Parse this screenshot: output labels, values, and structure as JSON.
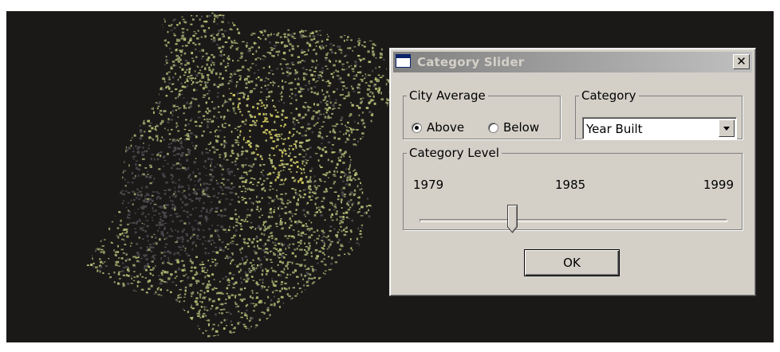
{
  "dialog": {
    "title": "Category Slider",
    "close_glyph": "✕",
    "city_average": {
      "legend": "City Average",
      "options": [
        "Above",
        "Below"
      ],
      "selected": "Above"
    },
    "category": {
      "legend": "Category",
      "selected": "Year Built"
    },
    "category_level": {
      "legend": "Category Level",
      "min_label": "1979",
      "mid_label": "1985",
      "max_label": "1999",
      "value_fraction": 0.3
    },
    "ok_label": "OK"
  },
  "map": {
    "colors": {
      "background": "#1b1918",
      "above": "#8f9a65",
      "above_light": "#b2b871",
      "highlight": "#c9c35a",
      "below": "#48474a"
    }
  },
  "icons": {
    "app": "window-icon",
    "close": "close-icon",
    "dropdown": "chevron-down-icon",
    "slider_thumb": "slider-thumb-icon"
  }
}
